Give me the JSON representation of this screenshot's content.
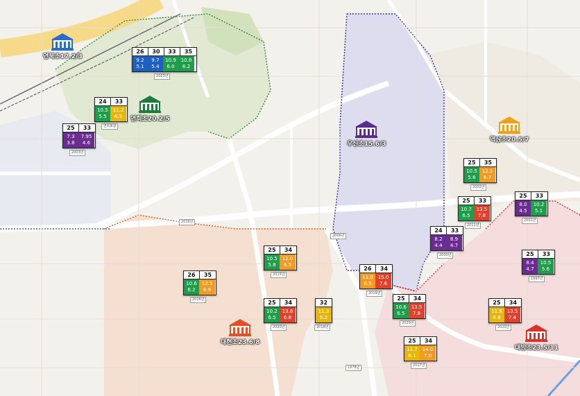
{
  "schools": [
    {
      "name": "연북초17.2/3",
      "color": "#2b6cc4"
    },
    {
      "name": "연희초20.2/5",
      "color": "#1f7a3e"
    },
    {
      "name": "우신초15.6/3",
      "color": "#5a2d8c"
    },
    {
      "name": "역삼초20.5/7",
      "color": "#f0a020"
    },
    {
      "name": "대현초23.6/8",
      "color": "#e2502a"
    },
    {
      "name": "대방초23.5/11",
      "color": "#d9342b"
    }
  ],
  "cards": [
    {
      "headers": [
        "26",
        "30",
        "33",
        "35"
      ],
      "cells": [
        {
          "t": "9.2",
          "b": "5.1",
          "color": "blue"
        },
        {
          "t": "9.7",
          "b": "5.4",
          "color": "blue"
        },
        {
          "t": "10.9",
          "b": "6.0",
          "color": "green"
        },
        {
          "t": "10.8",
          "b": "6.2",
          "color": "green"
        }
      ],
      "label": "2003년"
    },
    {
      "headers": [
        "24",
        "33"
      ],
      "cells": [
        {
          "t": "10.5",
          "b": "5.5",
          "color": "green"
        },
        {
          "t": "11.2",
          "b": "6.5",
          "color": "yellow"
        }
      ],
      "label": "연희로얄"
    },
    {
      "headers": [
        "25",
        "33"
      ],
      "cells": [
        {
          "t": "7.3",
          "b": "3.8",
          "color": "purple"
        },
        {
          "t": "7.95",
          "b": "4.6",
          "color": "purple"
        }
      ],
      "label": "2003년"
    },
    {
      "headers": [
        "25",
        "35"
      ],
      "cells": [
        {
          "t": "10.5",
          "b": "5.6",
          "color": "green"
        },
        {
          "t": "12.3",
          "b": "6.7",
          "color": "orange"
        }
      ],
      "label": "2002년"
    },
    {
      "headers": [
        "25",
        "33"
      ],
      "cells": [
        {
          "t": "10.7",
          "b": "6.5",
          "color": "green"
        },
        {
          "t": "13.5",
          "b": "7.8",
          "color": "red"
        }
      ],
      "label": "2011년"
    },
    {
      "headers": [
        "25",
        "33"
      ],
      "cells": [
        {
          "t": "8.0",
          "b": "4.5",
          "color": "purple"
        },
        {
          "t": "10.2",
          "b": "5.1",
          "color": "green"
        }
      ],
      "label": "2001년"
    },
    {
      "headers": [
        "24",
        "33"
      ],
      "cells": [
        {
          "t": "8.2",
          "b": "4.4",
          "color": "purple"
        },
        {
          "t": "8.9",
          "b": "4.7",
          "color": "purple"
        }
      ],
      "label": "2000년"
    },
    {
      "headers": [
        "25",
        "33"
      ],
      "cells": [
        {
          "t": "8.4",
          "b": "4.7",
          "color": "purple"
        },
        {
          "t": "10.5",
          "b": "5.6",
          "color": "green"
        }
      ],
      "label": "1997년"
    },
    {
      "headers": [
        "25",
        "34"
      ],
      "cells": [
        {
          "t": "10.5",
          "b": "5.8",
          "color": "green"
        },
        {
          "t": "12.0",
          "b": "6.5",
          "color": "orange"
        }
      ],
      "label": "2015년"
    },
    {
      "headers": [
        "26",
        "34"
      ],
      "cells": [
        {
          "t": "11.0",
          "b": "6.5",
          "color": "orange"
        },
        {
          "t": "15.0",
          "b": "7.6",
          "color": "red"
        }
      ],
      "label": "2019년"
    },
    {
      "headers": [
        "26",
        "35"
      ],
      "cells": [
        {
          "t": "10.6",
          "b": "6.2",
          "color": "green"
        },
        {
          "t": "12.5",
          "b": "6.9",
          "color": "orange"
        }
      ],
      "label": "2016년"
    },
    {
      "headers": [
        "25",
        "34"
      ],
      "cells": [
        {
          "t": "10.2",
          "b": "6.5",
          "color": "green"
        },
        {
          "t": "13.8",
          "b": "6.8",
          "color": "red"
        }
      ],
      "label": "2020년"
    },
    {
      "headers": [
        "32"
      ],
      "cells": [
        {
          "t": "11.3",
          "b": "6.2",
          "color": "yellow"
        }
      ],
      "label": "2018년"
    },
    {
      "headers": [
        "25",
        "34"
      ],
      "cells": [
        {
          "t": "10.6",
          "b": "6.5",
          "color": "green"
        },
        {
          "t": "13.5",
          "b": "7.8",
          "color": "red"
        }
      ],
      "label": "2020년"
    },
    {
      "headers": [
        "25",
        "34"
      ],
      "cells": [
        {
          "t": "11.6",
          "b": "6.8",
          "color": "yellow"
        },
        {
          "t": "13.5",
          "b": "7.4",
          "color": "red"
        }
      ],
      "label": "2020년"
    },
    {
      "headers": [
        "25",
        "34"
      ],
      "cells": [
        {
          "t": "11.7",
          "b": "6.1",
          "color": "yellow"
        },
        {
          "t": "14.0",
          "b": "7.0",
          "color": "orange"
        }
      ],
      "label": "2017년"
    }
  ],
  "extra_labels": [
    "2016년",
    "2006년",
    "1978년"
  ],
  "palette": {
    "green": "#1e9e4a",
    "orange": "#f59a20",
    "yellow": "#e8b60a",
    "purple": "#6a2c91",
    "blue": "#1f5fbf",
    "red": "#e2402a"
  }
}
